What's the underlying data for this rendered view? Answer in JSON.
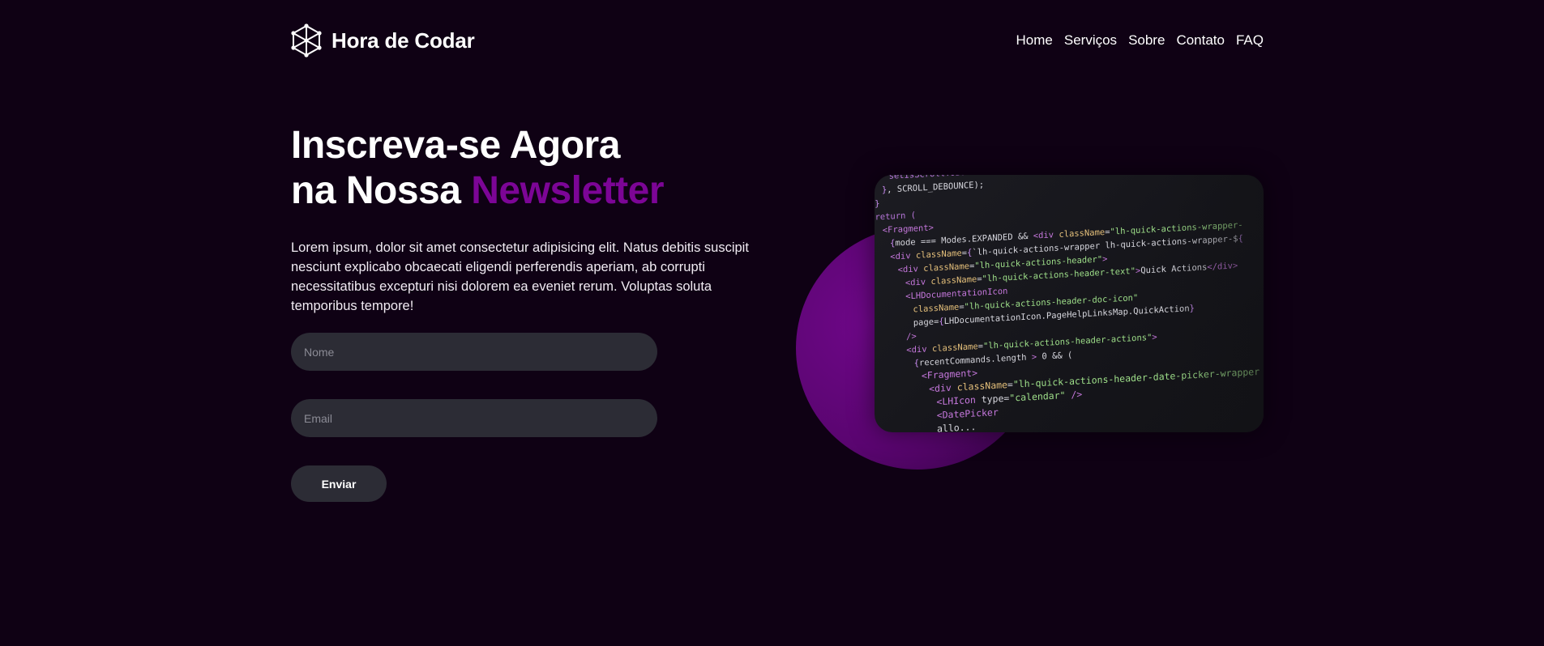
{
  "brand": {
    "name": "Hora de Codar",
    "logo_icon": "cube-network-icon"
  },
  "nav": {
    "items": [
      {
        "label": "Home"
      },
      {
        "label": "Serviços"
      },
      {
        "label": "Sobre"
      },
      {
        "label": "Contato"
      },
      {
        "label": "FAQ"
      }
    ]
  },
  "hero": {
    "title_line1": "Inscreva-se Agora",
    "title_line2_plain": "na Nossa",
    "title_line2_accent": "Newsletter",
    "description": "Lorem ipsum, dolor sit amet consectetur adipisicing elit. Natus debitis suscipit nesciunt explicabo obcaecati eligendi perferendis aperiam, ab corrupti necessitatibus excepturi nisi dolorem ea eveniet rerum. Voluptas soluta temporibus tempore!"
  },
  "form": {
    "name_placeholder": "Nome",
    "email_placeholder": "Email",
    "submit_label": "Enviar"
  },
  "code_image": {
    "lines": [
      "setIsScrollToBottom(...",
      "}, SCROLL_DEBOUNCE);",
      "}",
      "return (",
      "<Fragment>",
      "{mode === Modes.EXPANDED && <div className=\"lh-quick-actions-wrapper-",
      "<div className={`lh-quick-actions-wrapper lh-quick-actions-wrapper-${",
      "<div className=\"lh-quick-actions-header\">",
      "<div className=\"lh-quick-actions-header-text\">Quick Actions</div>",
      "<LHDocumentationIcon",
      "className=\"lh-quick-actions-header-doc-icon\"",
      "page={LHDocumentationIcon.PageHelpLinksMap.QuickAction}",
      "/>",
      "<div className=\"lh-quick-actions-header-actions\">",
      "{recentCommands.length > 0 && (",
      "<Fragment>",
      "<div className=\"lh-quick-actions-header-date-picker-wrapper",
      "<LHIcon type=\"calendar\" />",
      "<DatePicker",
      "allo..."
    ]
  },
  "colors": {
    "background": "#0f0114",
    "accent": "#7c0596",
    "field_bg": "#2c2c35"
  }
}
